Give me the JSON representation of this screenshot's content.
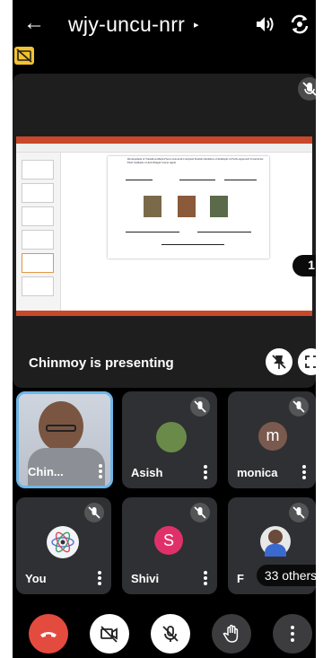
{
  "header": {
    "meeting_code": "wjy-uncu-nrr",
    "back_icon": "arrow-left-icon",
    "audio_icon": "speaker-icon",
    "camera_flip_icon": "camera-flip-icon",
    "badge_icon": "no-captions-icon"
  },
  "stage": {
    "presenting_label": "Chinmoy is presenting",
    "page_number": "1",
    "slide_title": "Development of Transition-Metal-Free Lewis Acid-Catalyzed Double Oxidation of Aldehyde: A Facile Approach Towards the Final Synthesis of Anti-Fungal Cancer Agent",
    "mic_state": "muted"
  },
  "participants": [
    {
      "name": "Chin...",
      "type": "camera",
      "muted": false
    },
    {
      "name": "Asish",
      "type": "photo",
      "muted": true
    },
    {
      "name": "monica",
      "type": "letter",
      "initial": "m",
      "color": "#7a5a4e",
      "muted": true
    },
    {
      "name": "You",
      "type": "photo",
      "muted": true
    },
    {
      "name": "Shivi",
      "type": "letter",
      "initial": "S",
      "color": "#e0306a",
      "muted": true
    },
    {
      "name": "F",
      "type": "photo",
      "muted": true
    }
  ],
  "others_label": "33 others",
  "controls": {
    "end_call_color": "#e44b3f",
    "camera_icon": "camera-off-icon",
    "mic_icon": "mic-off-icon",
    "hand_icon": "raise-hand-icon",
    "more_icon": "more-vert-icon"
  }
}
